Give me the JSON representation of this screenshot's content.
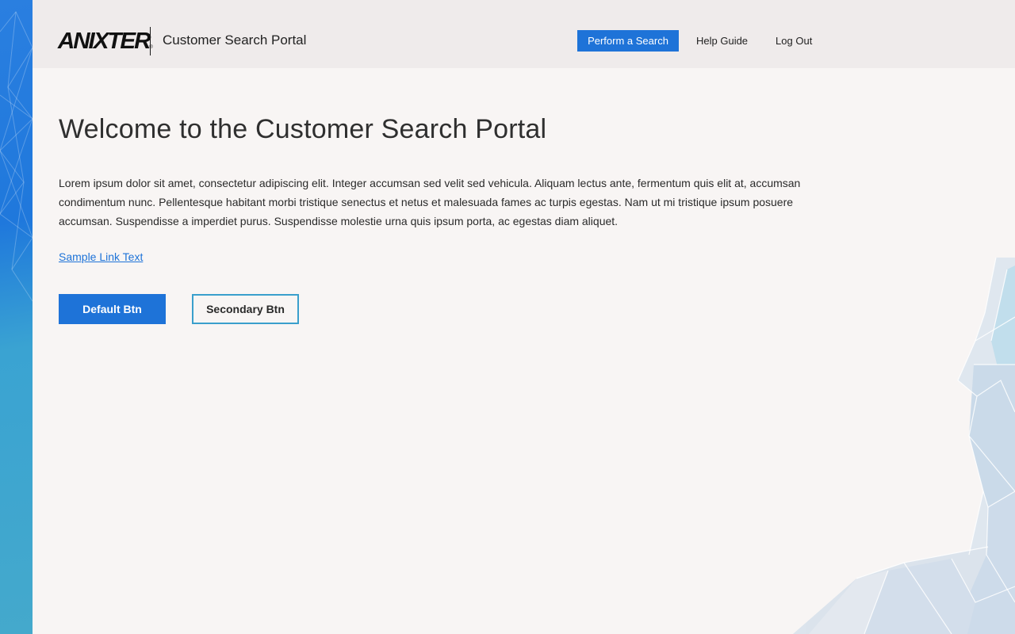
{
  "brand": {
    "logo_text": "ANIXTER",
    "logo_mark": "®",
    "portal_title": "Customer Search Portal",
    "accent_color": "#1e73d8",
    "secondary_border_color": "#3a9fcc"
  },
  "nav": {
    "perform_search": "Perform a Search",
    "help_guide": "Help Guide",
    "log_out": "Log Out"
  },
  "main": {
    "title": "Welcome to the Customer Search Portal",
    "intro": "Lorem ipsum dolor sit amet, consectetur adipiscing elit. Integer accumsan sed velit sed vehicula. Aliquam lectus ante, fermentum quis elit at, accumsan condimentum nunc. Pellentesque habitant morbi tristique senectus et netus et malesuada fames ac turpis egestas. Nam ut mi tristique ipsum posuere accumsan. Suspendisse a imperdiet purus. Suspendisse molestie urna quis ipsum porta, ac egestas diam aliquet.",
    "sample_link": "Sample Link Text",
    "default_button": "Default Btn",
    "secondary_button": "Secondary Btn"
  }
}
